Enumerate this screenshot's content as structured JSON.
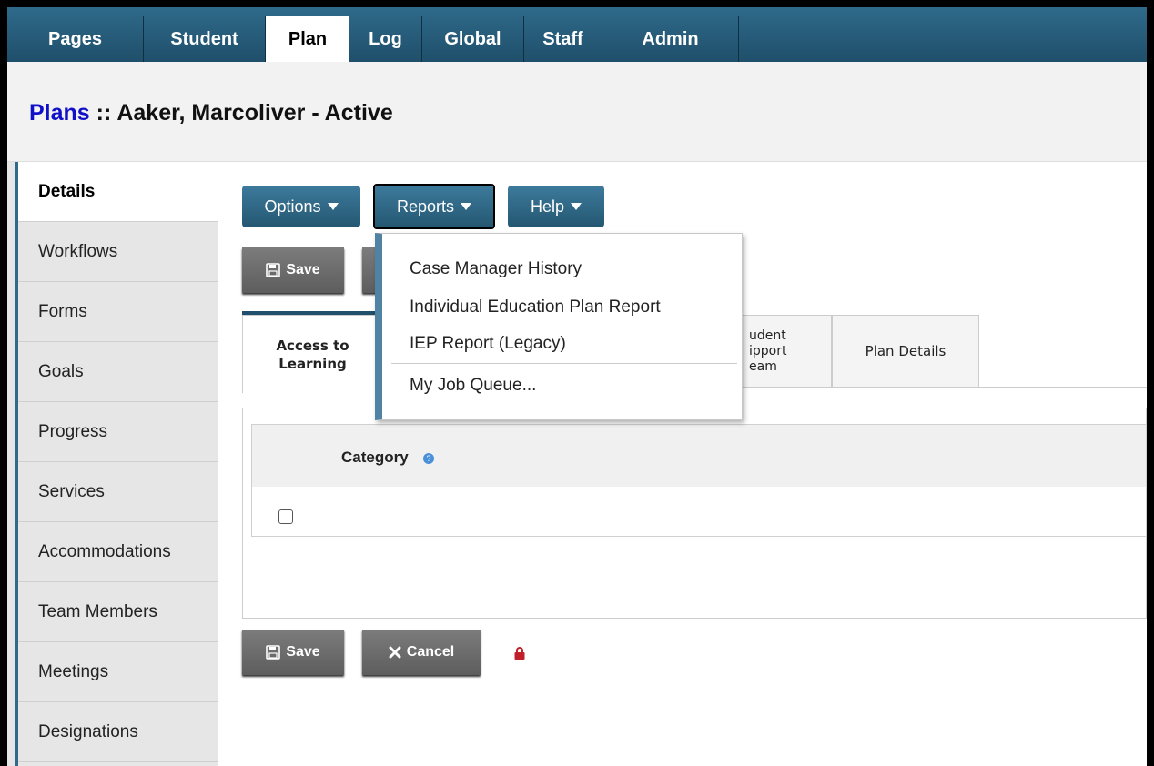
{
  "nav": {
    "tabs": [
      "Pages",
      "Student",
      "Plan",
      "Log",
      "Global",
      "Staff",
      "Admin"
    ],
    "active": "Plan"
  },
  "header": {
    "breadcrumb": "Plans",
    "separator": " :: ",
    "title": "Aaker, Marcoliver - Active"
  },
  "sidebar": {
    "items": [
      "Details",
      "Workflows",
      "Forms",
      "Goals",
      "Progress",
      "Services",
      "Accommodations",
      "Team Members",
      "Meetings",
      "Designations"
    ],
    "active": "Details"
  },
  "toolbar": {
    "options_label": "Options",
    "reports_label": "Reports",
    "help_label": "Help"
  },
  "actions": {
    "save_label": "Save",
    "cancel_label": "Cancel"
  },
  "reports_menu": {
    "items": [
      "Case Manager History",
      "Individual Education Plan Report",
      "IEP Report (Legacy)",
      "My Job Queue..."
    ]
  },
  "subtabs": {
    "access_line1": "Access to",
    "access_line2": "Learning",
    "student_line1": "udent",
    "student_line2": "ipport",
    "student_line3": "eam",
    "plan_details": "Plan Details"
  },
  "table": {
    "category_header": "Category",
    "help_icon": "?"
  },
  "colors": {
    "nav_bg": "#2f6a8a",
    "link_blue": "#1010c8",
    "button_gray": "#6b6b6b",
    "lock_red": "#c0202a"
  }
}
